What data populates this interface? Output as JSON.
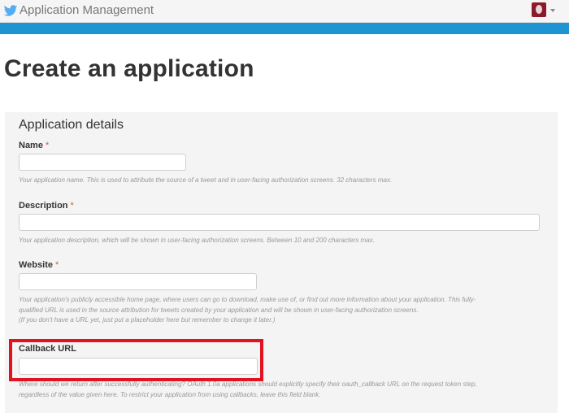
{
  "header": {
    "app_title": "Application Management",
    "logo_icon": "twitter-bird-icon",
    "avatar_icon": "user-avatar-icon",
    "caret_icon": "chevron-down-icon",
    "brand_color": "#1e95d0"
  },
  "page": {
    "title": "Create an application"
  },
  "form": {
    "section_title": "Application details",
    "required_marker": "*",
    "name": {
      "label": "Name",
      "value": "",
      "help": "Your application name. This is used to attribute the source of a tweet and in user-facing authorization screens. 32 characters max."
    },
    "description": {
      "label": "Description",
      "value": "",
      "help": "Your application description, which will be shown in user-facing authorization screens. Between 10 and 200 characters max."
    },
    "website": {
      "label": "Website",
      "value": "",
      "help_line1": "Your application's publicly accessible home page, where users can go to download, make use of, or find out more information about your application. This fully-",
      "help_line2": "qualified URL is used in the source attribution for tweets created by your application and will be shown in user-facing authorization screens.",
      "help_line3": "(If you don't have a URL yet, just put a placeholder here but remember to change it later.)"
    },
    "callback_url": {
      "label": "Callback URL",
      "value": "",
      "help_line1": "Where should we return after successfully authenticating? OAuth 1.0a applications should explicitly specify their oauth_callback URL on the request token step,",
      "help_line2": "regardless of the value given here. To restrict your application from using callbacks, leave this field blank.",
      "highlight_color": "#e1131f"
    }
  }
}
